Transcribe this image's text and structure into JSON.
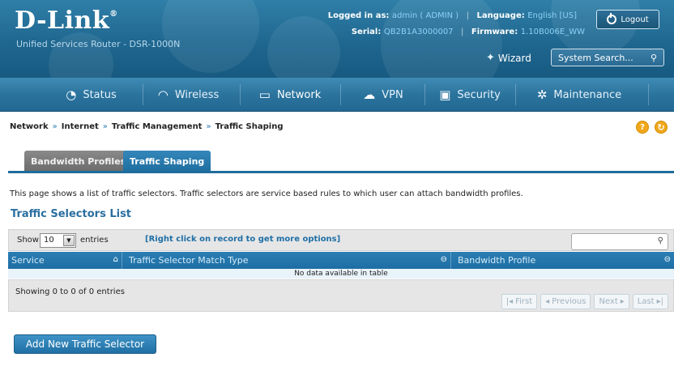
{
  "brand": {
    "logo": "D-Link",
    "reg_mark": "®",
    "subtitle": "Unified Services Router - DSR-1000N"
  },
  "session": {
    "logged_in_label": "Logged in as:",
    "user": "admin ( ADMIN )",
    "language_label": "Language:",
    "language": "English [US]",
    "serial_label": "Serial:",
    "serial": "QB2B1A3000007",
    "firmware_label": "Firmware:",
    "firmware": "1.10B006E_WW",
    "logout_label": "Logout"
  },
  "tools": {
    "wizard_label": "Wizard",
    "search_placeholder": "System Search..."
  },
  "nav": {
    "items": [
      {
        "label": "Status",
        "icon": "gauge-icon"
      },
      {
        "label": "Wireless",
        "icon": "wifi-icon"
      },
      {
        "label": "Network",
        "icon": "monitor-icon",
        "active": true
      },
      {
        "label": "VPN",
        "icon": "cloud-lock-icon"
      },
      {
        "label": "Security",
        "icon": "lock-icon"
      },
      {
        "label": "Maintenance",
        "icon": "gears-icon"
      }
    ]
  },
  "breadcrumb": [
    "Network",
    "Internet",
    "Traffic Management",
    "Traffic Shaping"
  ],
  "breadcrumb_sep": "»",
  "tabs": [
    {
      "label": "Bandwidth Profiles",
      "active": false
    },
    {
      "label": "Traffic Shaping",
      "active": true
    }
  ],
  "description": "This page shows a list of traffic selectors. Traffic selectors are service based rules to which user can attach bandwidth profiles.",
  "section_title": "Traffic Selectors List",
  "table": {
    "show_label": "Show",
    "entries_value": "10",
    "entries_label": "entries",
    "hint": "[Right click on record to get more options]",
    "columns": [
      {
        "label": "Service"
      },
      {
        "label": "Traffic Selector Match Type"
      },
      {
        "label": "Bandwidth Profile"
      }
    ],
    "empty_message": "No data available in table",
    "showing": "Showing 0 to 0 of 0 entries",
    "pager": {
      "first": "First",
      "previous": "Previous",
      "next": "Next",
      "last": "Last"
    }
  },
  "add_button_label": "Add New Traffic Selector"
}
